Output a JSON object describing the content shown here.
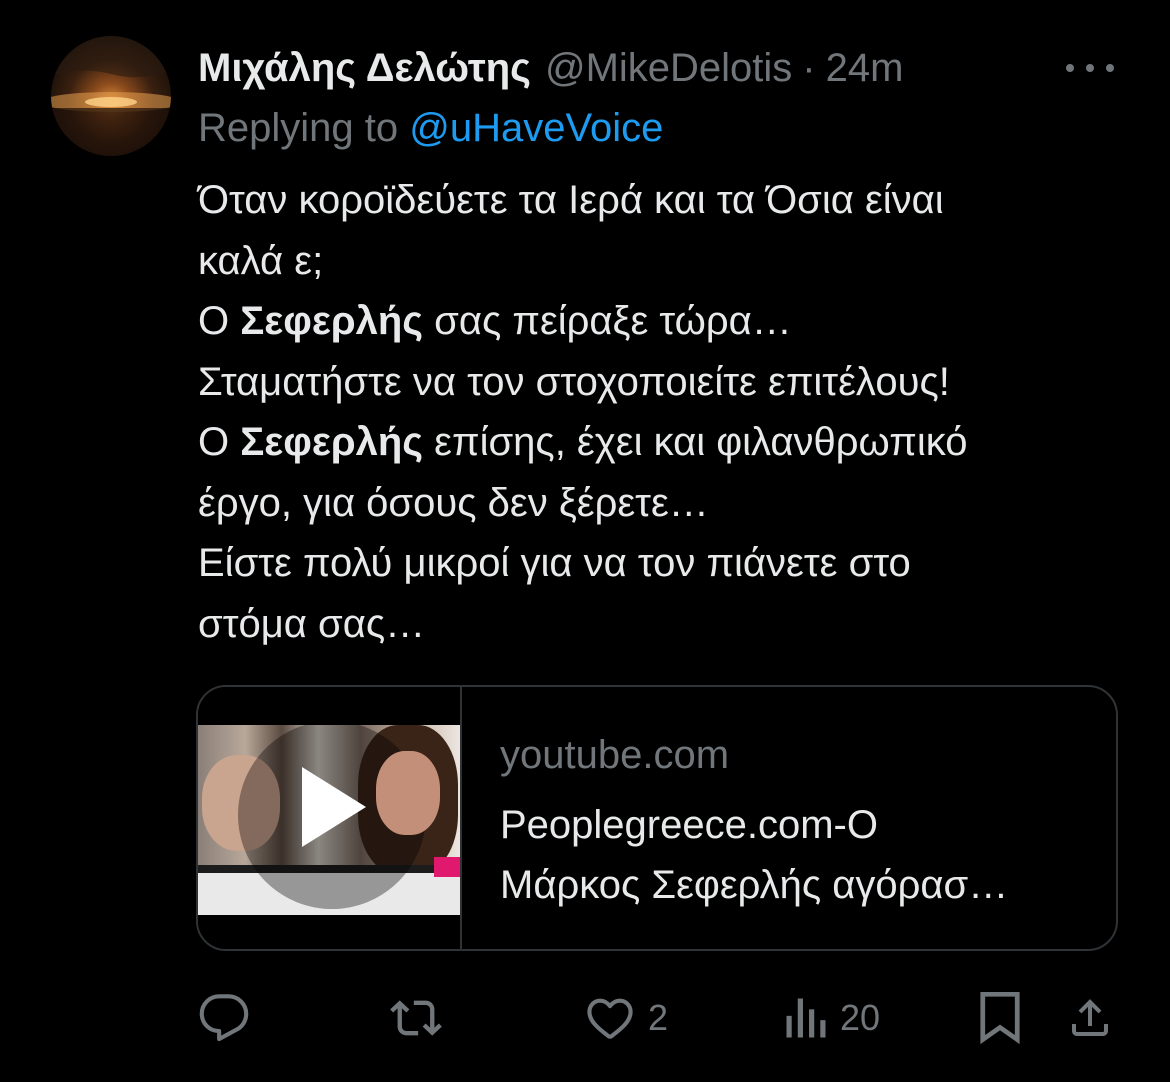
{
  "author": {
    "display_name": "Μιχάλης Δελώτης",
    "handle": "@MikeDelotis",
    "separator": "·",
    "time": "24m"
  },
  "reply": {
    "prefix": "Replying to",
    "mention": "@uHaveVoice"
  },
  "body": {
    "line1": "Όταν κοροϊδεύετε τα Ιερά και τα Όσια είναι",
    "line2": "καλά ε;",
    "line3_pre": "Ο ",
    "line3_bold": "Σεφερλής",
    "line3_post": " σας πείραξε τώρα…",
    "line4": "Σταματήστε να τον στοχοποιείτε επιτέλους!",
    "line5_pre": "Ο ",
    "line5_bold": "Σεφερλής",
    "line5_post": " επίσης, έχει και φιλανθρωπικό",
    "line6": "έργο, για όσους δεν ξέρετε…",
    "line7": "Είστε πολύ μικροί για να τον πιάνετε στο",
    "line8": "στόμα σας…"
  },
  "card": {
    "domain": "youtube.com",
    "title_line1": "Peoplegreece.com-Ο",
    "title_line2": "Μάρκος Σεφερλής αγόρασ…"
  },
  "actions": {
    "reply_count": "",
    "retweet_count": "",
    "like_count": "2",
    "views_count": "20"
  },
  "icons": {
    "more": "more-icon",
    "reply": "reply-icon",
    "retweet": "retweet-icon",
    "like": "heart-icon",
    "views": "views-icon",
    "bookmark": "bookmark-icon",
    "share": "share-icon",
    "play": "play-icon"
  },
  "colors": {
    "background": "#000000",
    "text": "#e7e9ea",
    "muted": "#71767b",
    "link": "#1d9bf0",
    "border": "#2f3336"
  }
}
